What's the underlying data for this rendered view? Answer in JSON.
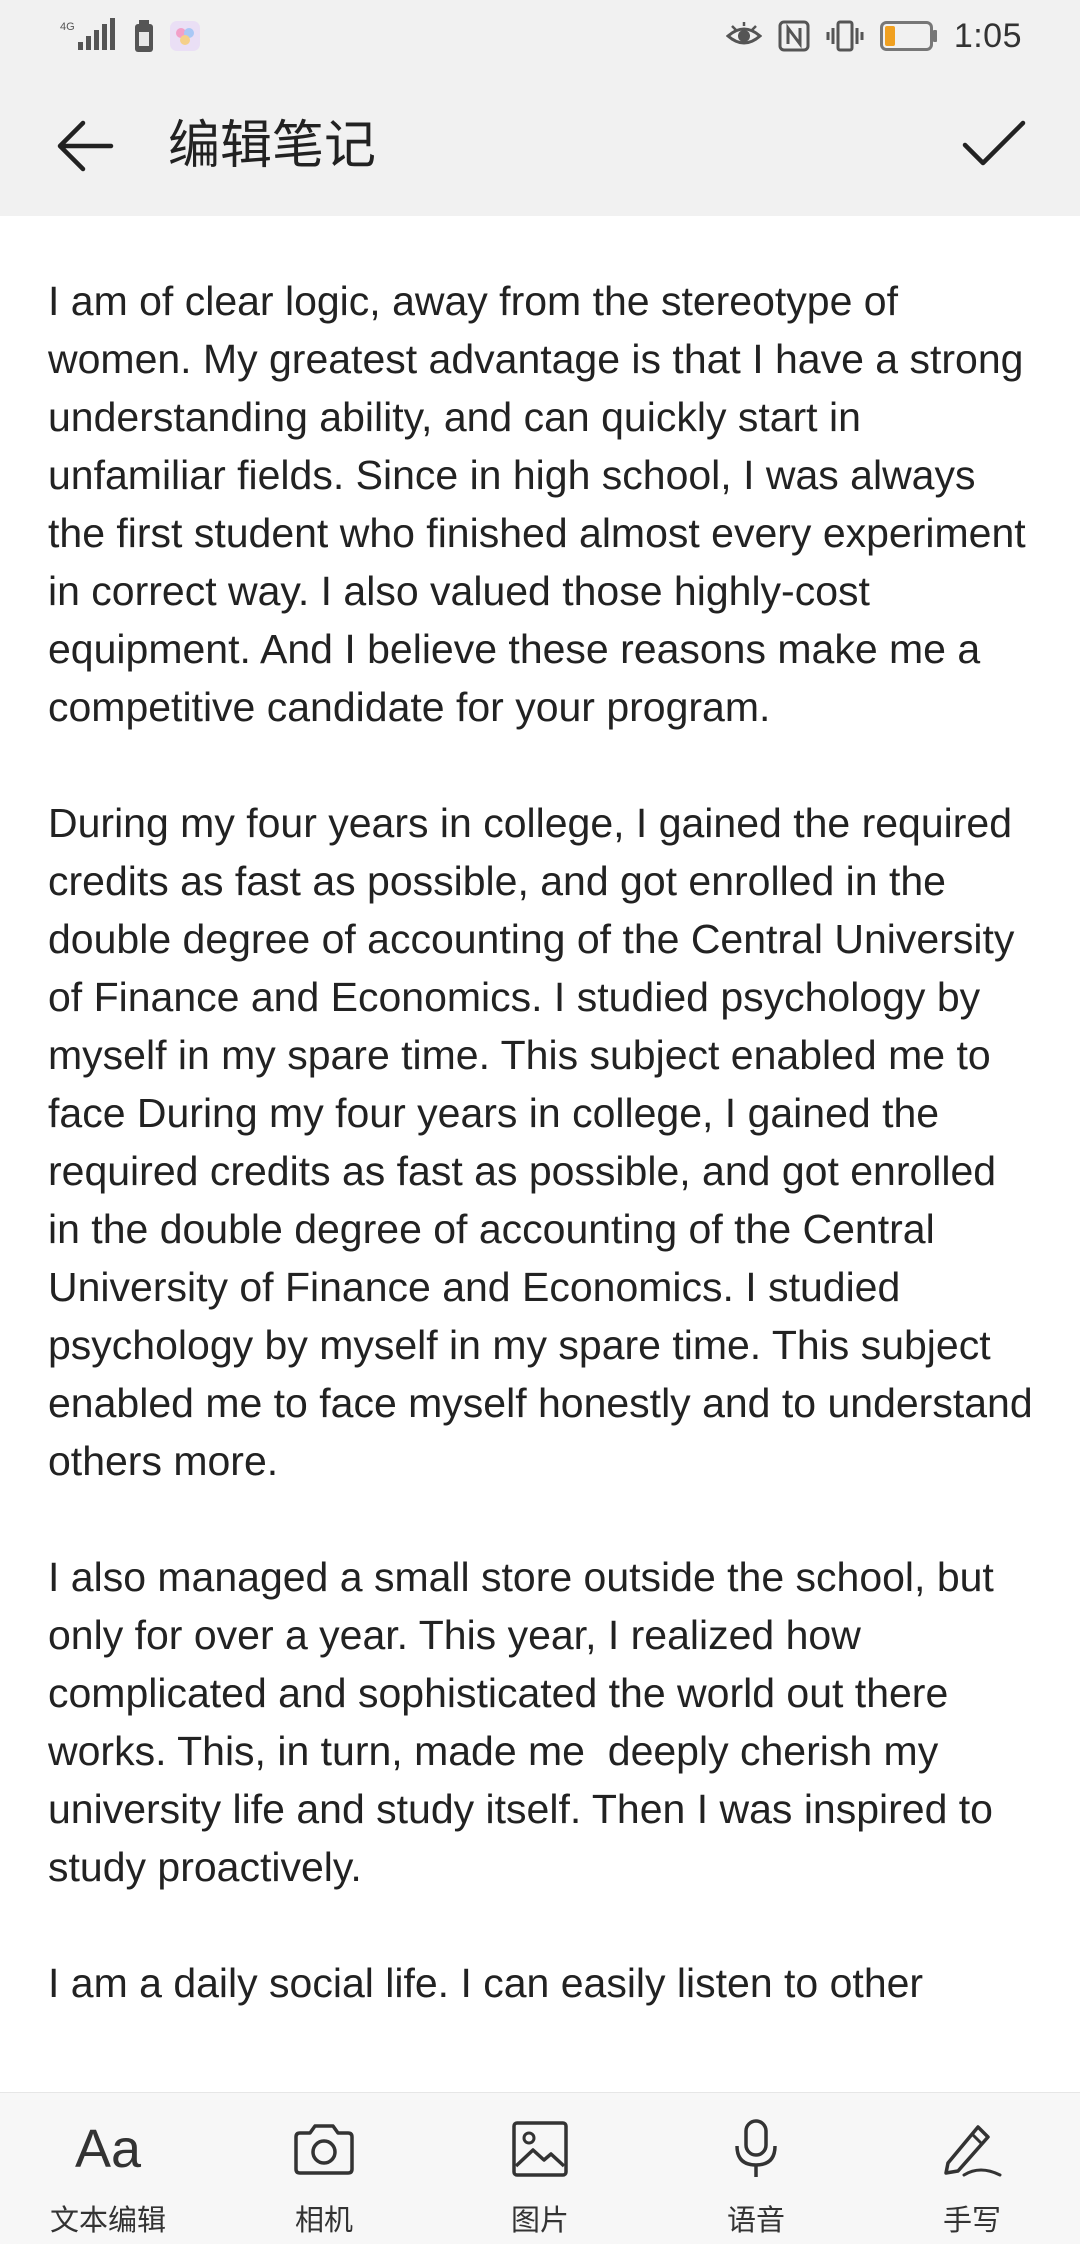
{
  "status_bar": {
    "network_label": "4G",
    "time": "1:05"
  },
  "header": {
    "title": "编辑笔记"
  },
  "note": {
    "paragraphs": [
      "I am of clear logic, away from the stereotype of women. My greatest advantage is that I have a strong understanding ability, and can quickly start in unfamiliar fields. Since in high school, I was always the first student who finished almost every experiment in correct way. I also valued those highly-cost equipment. And I believe these reasons make me a competitive candidate for your program.",
      "During my four years in college, I gained the required credits as fast as possible, and got enrolled in the double degree of accounting of the Central University of Finance and Economics. I studied psychology by myself in my spare time. This subject enabled me to face During my four years in college, I gained the required credits as fast as possible, and got enrolled in the double degree of accounting of the Central University of Finance and Economics. I studied psychology by myself in my spare time. This subject enabled me to face myself honestly and to understand others more.",
      "I also managed a small store outside the school, but only for over a year. This year, I realized how complicated and sophisticated the world out there works. This, in turn, made me  deeply cherish my university life and study itself. Then I was inspired to study proactively.",
      "I am a daily social life. I can easily listen to other"
    ]
  },
  "toolbar": {
    "items": [
      {
        "label": "文本编辑",
        "icon": "text-format-icon",
        "glyph": "Aa"
      },
      {
        "label": "相机",
        "icon": "camera-icon"
      },
      {
        "label": "图片",
        "icon": "image-icon"
      },
      {
        "label": "语音",
        "icon": "microphone-icon"
      },
      {
        "label": "手写",
        "icon": "handwriting-pen-icon"
      }
    ]
  }
}
